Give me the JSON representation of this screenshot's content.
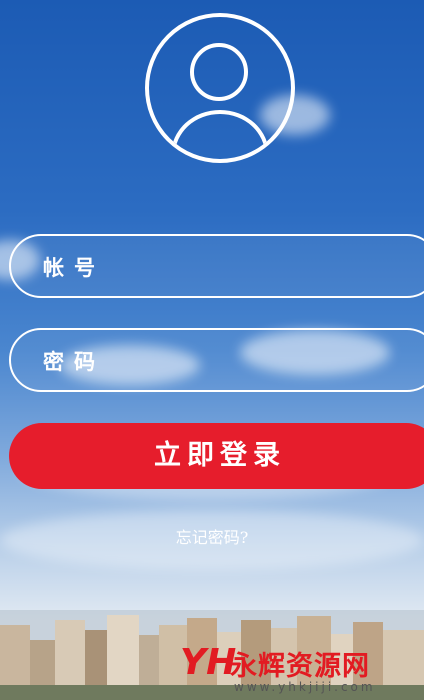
{
  "avatar": {
    "icon": "user-icon"
  },
  "username_field": {
    "label": "帐号",
    "value": "",
    "placeholder": ""
  },
  "password_field": {
    "label": "密码",
    "value": "",
    "placeholder": ""
  },
  "login_button": {
    "label": "立即登录"
  },
  "forgot_link": {
    "label": "忘记密码?"
  },
  "watermark": {
    "logo": "YH",
    "name": "永辉资源网",
    "url": "www.yhkjiji.com"
  },
  "colors": {
    "accent": "#e61d2c",
    "sky_top": "#1c5bb4"
  }
}
